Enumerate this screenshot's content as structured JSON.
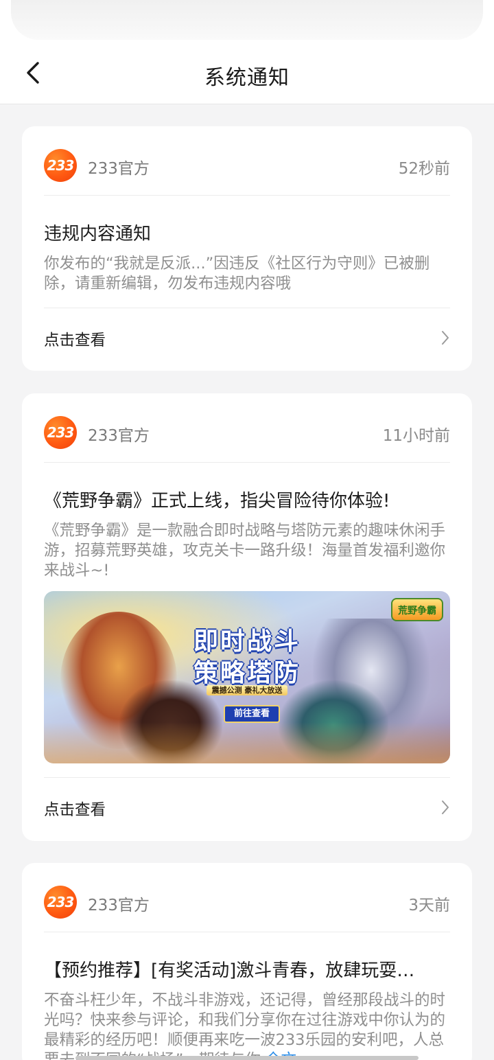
{
  "header": {
    "title": "系统通知"
  },
  "notifications": [
    {
      "sender": "233官方",
      "logo_text": "233",
      "time": "52秒前",
      "title": "违规内容通知",
      "body": "你发布的“我就是反派...”因违反《社区行为守则》已被删除，请重新编辑，勿发布违规内容哦",
      "action": "点击查看"
    },
    {
      "sender": "233官方",
      "logo_text": "233",
      "time": "11小时前",
      "title": "《荒野争霸》正式上线，指尖冒险待你体验!",
      "body": "《荒野争霸》是一款融合即时战略与塔防元素的趣味休闲手游，招募荒野英雄，攻克关卡一路升级！海量首发福利邀你来战斗~!",
      "banner": {
        "line1": "即时战斗",
        "line2": "策略塔防",
        "subtitle": "震撼公测 豪礼大放送",
        "cta": "前往查看",
        "game_logo": "荒野争霸"
      },
      "action": "点击查看"
    },
    {
      "sender": "233官方",
      "logo_text": "233",
      "time": "3天前",
      "title": "【预约推荐】[有奖活动]激斗青春，放肆玩耍…",
      "body": "不奋斗枉少年，不战斗非游戏，还记得，曾经那段战斗的时光吗？快来参与评论，和我们分享你在过往游戏中你认为的最精彩的经历吧！顺便再来吃一波233乐园的安利吧，人总要去到不同的“战场”，期待与你",
      "more": "全文"
    }
  ],
  "colors": {
    "accent": "#ff5a12",
    "link": "#2b8de8",
    "background": "#f4f4f5"
  }
}
